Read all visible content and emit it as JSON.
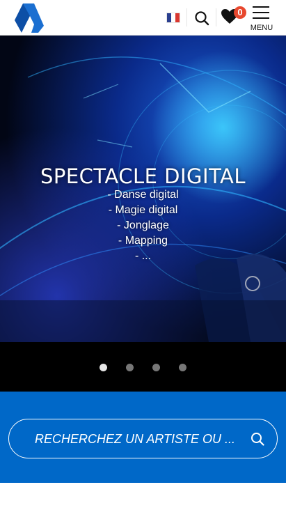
{
  "header": {
    "logo": "brand-logo",
    "language_flag": "fr-flag",
    "flag_colors": [
      "#2a3f8f",
      "#ffffff",
      "#d9372f"
    ],
    "favorites_count": "0",
    "menu_label": "MENU"
  },
  "hero": {
    "title": "SPECTACLE DIGITAL",
    "lines": [
      "- Danse digital",
      "- Magie digital",
      "- Jonglage",
      "- Mapping",
      "- ..."
    ],
    "slide_count": 4,
    "active_slide": 1
  },
  "search": {
    "placeholder": "RECHERCHEZ UN ARTISTE OU ...",
    "icon": "search-icon"
  },
  "colors": {
    "brand_blue": "#0068c8",
    "badge_red": "#e8482e"
  }
}
